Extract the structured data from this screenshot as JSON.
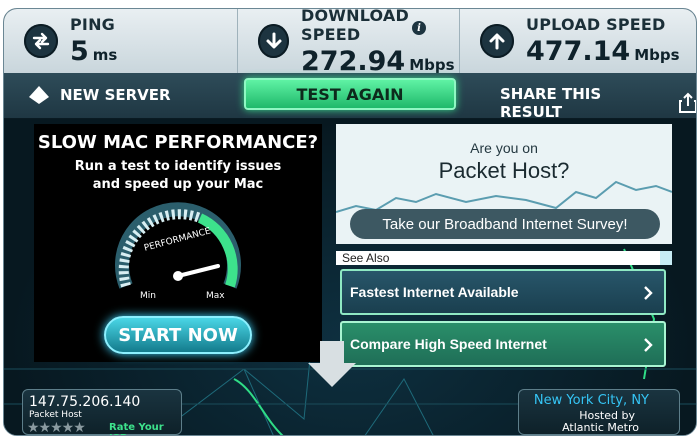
{
  "stats": {
    "ping": {
      "label": "PING",
      "value": "5",
      "unit": "ms"
    },
    "download": {
      "label": "DOWNLOAD SPEED",
      "value": "272.94",
      "unit": "Mbps",
      "info": "i"
    },
    "upload": {
      "label": "UPLOAD SPEED",
      "value": "477.14",
      "unit": "Mbps"
    }
  },
  "actions": {
    "new_server": "NEW SERVER",
    "test_again": "TEST AGAIN",
    "share": "SHARE THIS RESULT"
  },
  "ad_left": {
    "title": "SLOW MAC PERFORMANCE?",
    "subtitle_line1": "Run a test to identify issues",
    "subtitle_line2": "and speed up your Mac",
    "gauge_label": "PERFORMANCE",
    "gauge_min": "Min",
    "gauge_max": "Max",
    "button": "START NOW"
  },
  "ad_right": {
    "question": "Are you on",
    "brand": "Packet Host?",
    "survey_button": "Take our Broadband Internet Survey!",
    "see_also": "See Also"
  },
  "links": [
    {
      "label": "Fastest Internet Available"
    },
    {
      "label": "Compare High Speed Internet"
    }
  ],
  "isp": {
    "ip": "147.75.206.140",
    "name": "Packet Host",
    "stars": "★★★★★",
    "rate": "Rate Your ISP"
  },
  "server": {
    "city": "New York City, NY",
    "hosted": "Hosted by",
    "name": "Atlantic Metro"
  },
  "colors": {
    "accent_green": "#1fb96b",
    "accent_blue": "#35c5f5",
    "panel_dark": "#0e2430"
  }
}
